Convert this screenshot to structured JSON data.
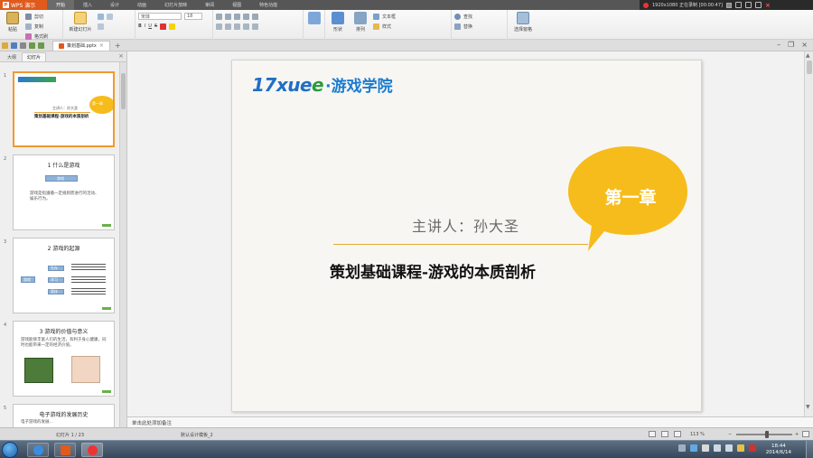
{
  "menubar": {
    "app_label": "WPS 演示",
    "items": [
      "开始",
      "插入",
      "设计",
      "动画",
      "幻灯片放映",
      "审阅",
      "视图",
      "特色功能"
    ],
    "recorder_text": "1920x1080  正在录制 [00:00:47]"
  },
  "ribbon": {
    "paste_label": "粘贴",
    "cut_label": "剪切",
    "copy_label": "复制",
    "format_painter_label": "格式刷",
    "new_slide_label": "新建幻灯片",
    "font_name": "宋体",
    "font_size": "18",
    "shape_label": "形状",
    "arrange_label": "排列",
    "style_label": "样式",
    "textbox_label": "文本框",
    "find_label": "查找",
    "replace_label": "替换",
    "select_pane_label": "选择窗格"
  },
  "tabstrip": {
    "doc_name": "策划基础.pptx"
  },
  "leftpane": {
    "tabs": [
      "大纲",
      "幻灯片"
    ],
    "thumbs": [
      {
        "num": "1",
        "title": "策划基础课程-游戏的本质剖析",
        "presenter": "主讲人：孙大圣",
        "badge": "第一章"
      },
      {
        "num": "2",
        "title": "1 什么是游戏",
        "box": "游戏",
        "text": "游戏是指遵循一定规则而进行的活动、娱乐行为。"
      },
      {
        "num": "3",
        "title": "2 游戏的起源",
        "box1": "游戏",
        "box2": "生存",
        "box3": "学习",
        "box4": "竞技"
      },
      {
        "num": "4",
        "title": "3 游戏的价值与意义",
        "text": "游戏能够丰富人们的生活，有利于身心健康，同时也能带来一定的经济价值。"
      },
      {
        "num": "5",
        "title": "电子游戏的发展历史",
        "text": "电子游戏的发展..."
      }
    ]
  },
  "slide": {
    "logo_en_a": "17xue",
    "logo_en_b": "e",
    "logo_cn": "·游戏学院",
    "presenter": "主讲人：孙大圣",
    "title": "策划基础课程-游戏的本质剖析",
    "badge": "第一章",
    "bubble_color": "#f6bc1b",
    "line_color": "#e2a93b"
  },
  "notes": {
    "placeholder": "单击此处添加备注"
  },
  "statusbar": {
    "slide_counter": "幻灯片 1 / 23",
    "template": "默认设计模板_2",
    "zoom": "113 %",
    "zoom_fraction": 0.55
  },
  "taskbar": {
    "time": "18:44",
    "date": "2014/6/14"
  }
}
